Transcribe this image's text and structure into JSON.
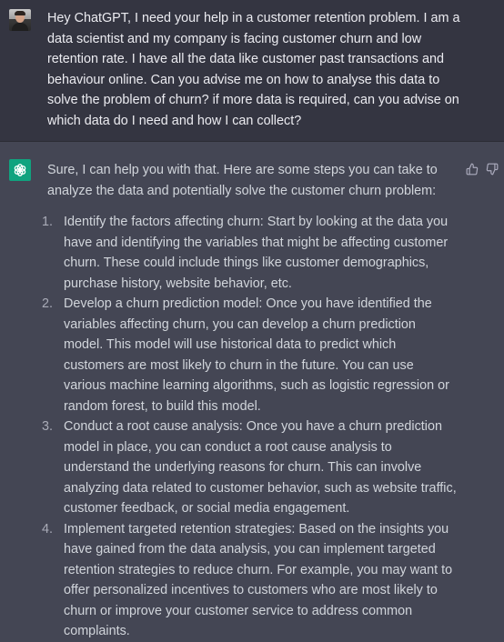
{
  "user_message": {
    "text": "Hey ChatGPT, I need your help in a customer retention problem. I am a data scientist and my company is facing customer churn and low retention rate. I have all the data like customer past transactions and behaviour online. Can you advise me on how to analyse this data to solve the problem of churn? if more data is required, can you advise on which data do I need and how I can collect?"
  },
  "assistant_message": {
    "intro": "Sure, I can help you with that. Here are some steps you can take to analyze the data and potentially solve the customer churn problem:",
    "items": [
      {
        "number": "1.",
        "text": "Identify the factors affecting churn: Start by looking at the data you have and identifying the variables that might be affecting customer churn. These could include things like customer demographics, purchase history, website behavior, etc."
      },
      {
        "number": "2.",
        "text": "Develop a churn prediction model: Once you have identified the variables affecting churn, you can develop a churn prediction model. This model will use historical data to predict which customers are most likely to churn in the future. You can use various machine learning algorithms, such as logistic regression or random forest, to build this model."
      },
      {
        "number": "3.",
        "text": "Conduct a root cause analysis: Once you have a churn prediction model in place, you can conduct a root cause analysis to understand the underlying reasons for churn. This can involve analyzing data related to customer behavior, such as website traffic, customer feedback, or social media engagement."
      },
      {
        "number": "4.",
        "text": "Implement targeted retention strategies: Based on the insights you have gained from the data analysis, you can implement targeted retention strategies to reduce churn. For example, you may want to offer personalized incentives to customers who are most likely to churn or improve your customer service to address common complaints."
      }
    ]
  },
  "icons": {
    "user_avatar": "user-avatar-photo",
    "assistant_avatar": "openai-logo-icon",
    "feedback_up": "thumbs-up-icon",
    "feedback_down": "thumbs-down-icon"
  },
  "colors": {
    "user_bg": "#343541",
    "assistant_bg": "#444654",
    "assistant_avatar_bg": "#10a37f"
  }
}
